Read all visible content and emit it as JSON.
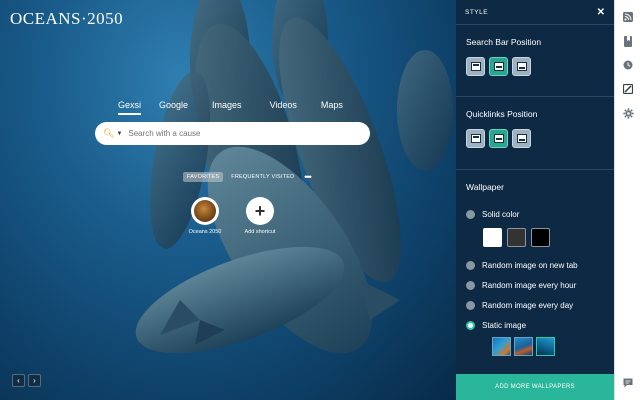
{
  "logo": "OCEANS·2050",
  "search": {
    "tabs": [
      "Gexsi",
      "Google",
      "Images",
      "Videos",
      "Maps"
    ],
    "placeholder": "Search with a cause"
  },
  "quicklinks": {
    "tabs": [
      "FAVORITES",
      "FREQUENTLY VISITED"
    ],
    "more": "•••",
    "shortcuts": [
      {
        "label": "Oceans 2050"
      },
      {
        "label": "Add shortcut",
        "icon": "+"
      }
    ]
  },
  "nav": {
    "prev": "‹",
    "next": "›"
  },
  "panel": {
    "title": "STYLE",
    "close": "✕",
    "search_bar_position": "Search Bar Position",
    "quicklinks_position": "Quicklinks Position",
    "wallpaper": {
      "title": "Wallpaper",
      "options": [
        "Solid color",
        "Random image on new tab",
        "Random image every hour",
        "Random image every day",
        "Static image"
      ],
      "selected": "Static image",
      "solid_colors": [
        "#ffffff",
        "#333333",
        "#000000"
      ]
    },
    "add_more": "ADD MORE WALLPAPERS"
  },
  "rail": {
    "icons": [
      "rss-icon",
      "bookmark-icon",
      "history-icon",
      "style-icon",
      "gear-icon",
      "feedback-icon"
    ],
    "active": "style-icon"
  },
  "colors": {
    "accent": "#2ab69a",
    "panel_bg": "#0d2943"
  }
}
